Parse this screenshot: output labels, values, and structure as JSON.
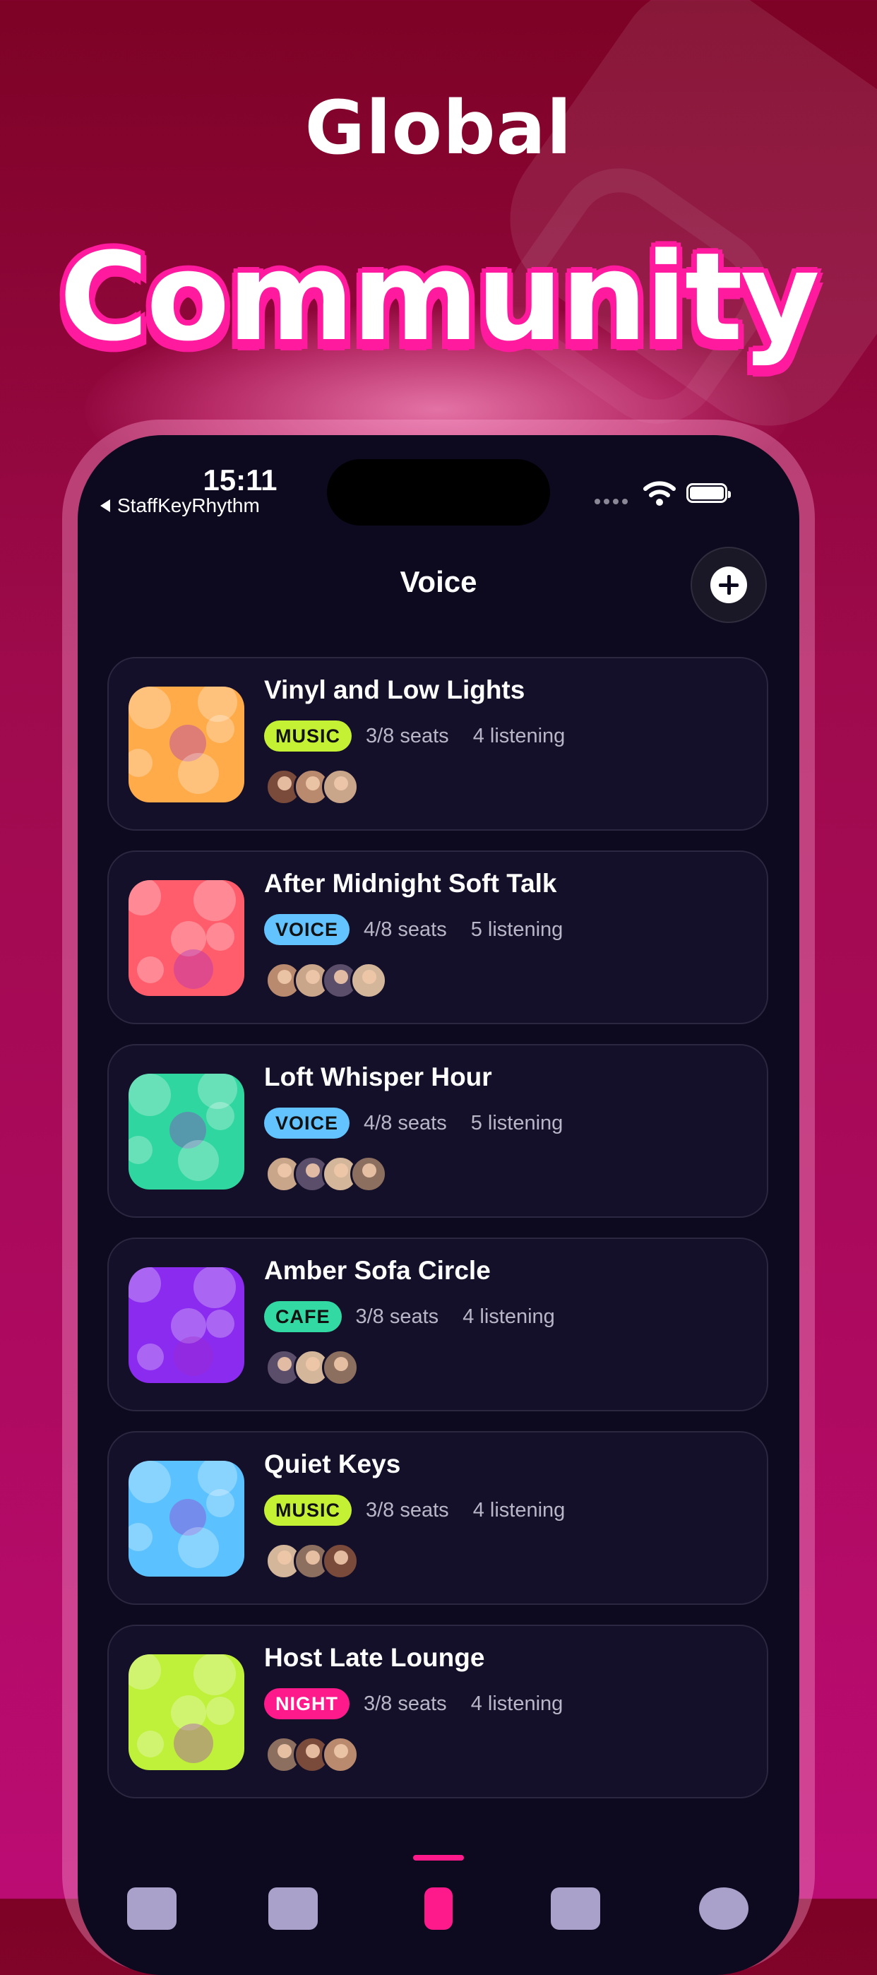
{
  "promo": {
    "headline_top": "Global",
    "headline_main": "Community"
  },
  "status_bar": {
    "time": "15:11",
    "back_app": "StaffKeyRhythm"
  },
  "header": {
    "title": "Voice",
    "add_icon": "plus-circle-icon"
  },
  "tag_colors": {
    "MUSIC": "#c5f135",
    "VOICE": "#62c3ff",
    "CAFE": "#33d9a3",
    "NIGHT": "#ff1a8c"
  },
  "rooms": [
    {
      "title": "Vinyl and Low Lights",
      "tag": "MUSIC",
      "seats": "3/8 seats",
      "listening": "4 listening",
      "cover_color": "#ffab4a",
      "avatar_count": 3
    },
    {
      "title": "After Midnight Soft Talk",
      "tag": "VOICE",
      "seats": "4/8 seats",
      "listening": "5 listening",
      "cover_color": "#ff5d6c",
      "avatar_count": 4
    },
    {
      "title": "Loft Whisper Hour",
      "tag": "VOICE",
      "seats": "4/8 seats",
      "listening": "5 listening",
      "cover_color": "#2fd69f",
      "avatar_count": 4
    },
    {
      "title": "Amber Sofa Circle",
      "tag": "CAFE",
      "seats": "3/8 seats",
      "listening": "4 listening",
      "cover_color": "#8a2bef",
      "avatar_count": 3
    },
    {
      "title": "Quiet Keys",
      "tag": "MUSIC",
      "seats": "3/8 seats",
      "listening": "4 listening",
      "cover_color": "#5cc2ff",
      "avatar_count": 3
    },
    {
      "title": "Host Late Lounge",
      "tag": "NIGHT",
      "seats": "3/8 seats",
      "listening": "4 listening",
      "cover_color": "#bff03a",
      "avatar_count": 3
    }
  ],
  "tab_bar": {
    "active_index": 2
  }
}
